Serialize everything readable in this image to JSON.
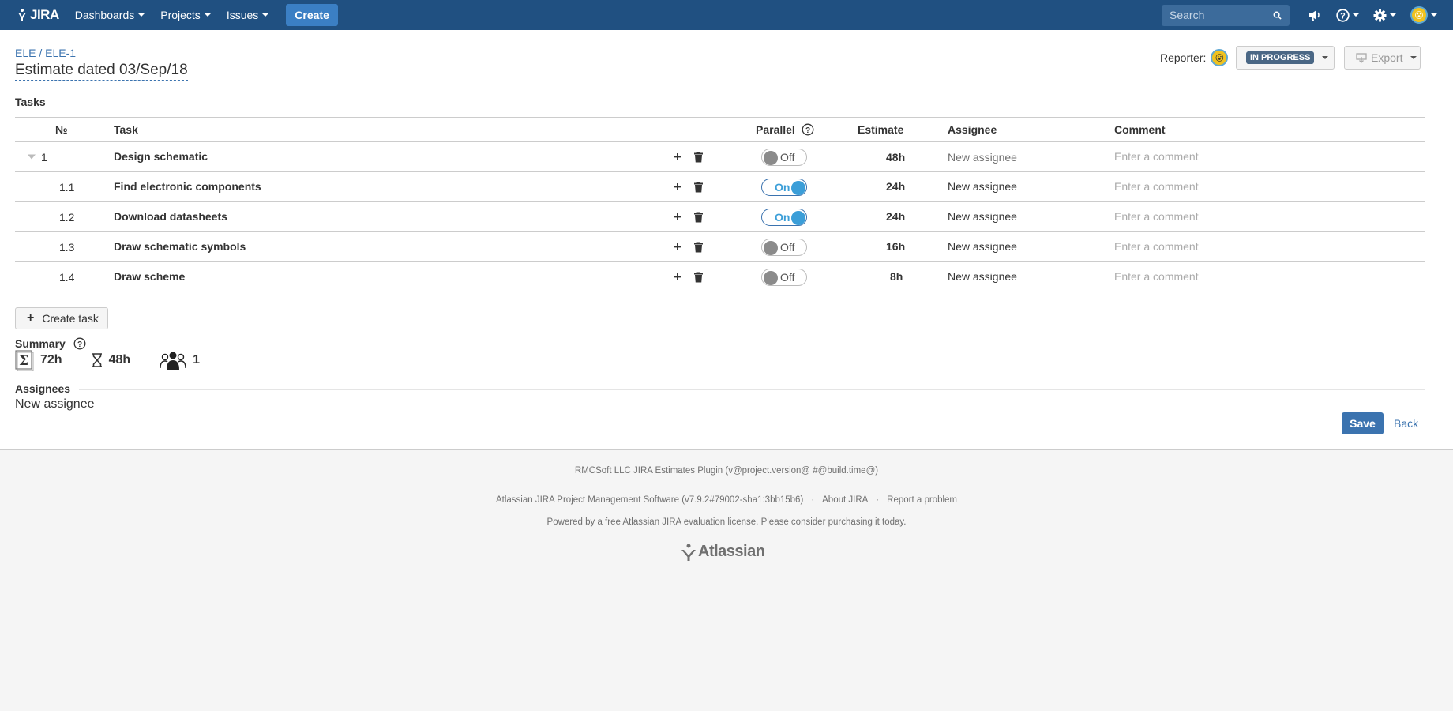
{
  "header": {
    "logo_text": "JIRA",
    "nav": [
      {
        "label": "Dashboards"
      },
      {
        "label": "Projects"
      },
      {
        "label": "Issues"
      }
    ],
    "create_label": "Create",
    "search_placeholder": "Search"
  },
  "breadcrumb": {
    "project": "ELE",
    "separator": " / ",
    "issue": "ELE-1"
  },
  "page_title": "Estimate dated 03/Sep/18",
  "reporter_label": "Reporter:",
  "status": "IN PROGRESS",
  "export_label": "Export",
  "tasks_section": "Tasks",
  "table": {
    "headers": {
      "no": "№",
      "task": "Task",
      "parallel": "Parallel",
      "estimate": "Estimate",
      "assignee": "Assignee",
      "comment": "Comment"
    },
    "rows": [
      {
        "no": "1",
        "task": "Design schematic",
        "parallel": "Off",
        "estimate": "48h",
        "assignee": "New assignee",
        "comment": "Enter a comment"
      },
      {
        "no": "1.1",
        "task": "Find electronic components",
        "parallel": "On",
        "estimate": "24h",
        "assignee": "New assignee",
        "comment": "Enter a comment"
      },
      {
        "no": "1.2",
        "task": "Download datasheets",
        "parallel": "On",
        "estimate": "24h",
        "assignee": "New assignee",
        "comment": "Enter a comment"
      },
      {
        "no": "1.3",
        "task": "Draw schematic symbols",
        "parallel": "Off",
        "estimate": "16h",
        "assignee": "New assignee",
        "comment": "Enter a comment"
      },
      {
        "no": "1.4",
        "task": "Draw scheme",
        "parallel": "Off",
        "estimate": "8h",
        "assignee": "New assignee",
        "comment": "Enter a comment"
      }
    ]
  },
  "create_task_label": "Create task",
  "summary": {
    "label": "Summary",
    "total": "72h",
    "duration": "48h",
    "people": "1"
  },
  "assignees": {
    "label": "Assignees",
    "value": "New assignee"
  },
  "save_label": "Save",
  "back_label": "Back",
  "footer": {
    "plugin": "RMCSoft LLC JIRA Estimates Plugin (v@project.version@ #@build.time@)",
    "software": "Atlassian JIRA Project Management Software (v7.9.2#79002-sha1:3bb15b6)",
    "about": "About JIRA",
    "report": "Report a problem",
    "license": "Powered by a free Atlassian JIRA evaluation license. Please consider purchasing it today.",
    "brand": "Atlassian"
  },
  "colors": {
    "header_bg": "#205081",
    "link": "#3b73af",
    "toggle_on": "#3b9ed8",
    "status_lozenge": "#4a6785"
  }
}
